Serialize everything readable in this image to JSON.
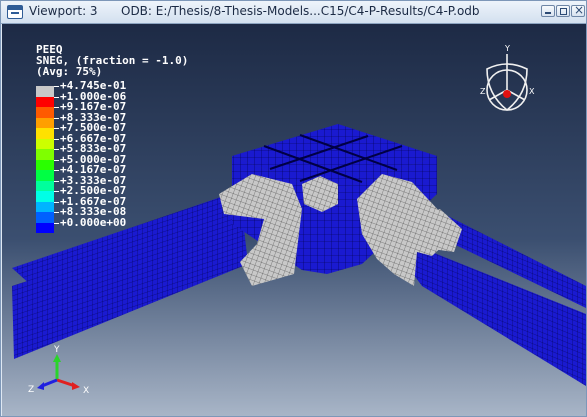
{
  "window": {
    "viewport_label": "Viewport: 3",
    "odb_path": "ODB: E:/Thesis/8-Thesis-Models...C15/C4-P-Results/C4-P.odb"
  },
  "legend": {
    "title_lines": [
      "PEEQ",
      "SNEG, (fraction = -1.0)",
      "(Avg: 75%)"
    ],
    "levels": [
      {
        "label": "+4.745e-01",
        "color": "#c8c8c8"
      },
      {
        "label": "+1.000e-06",
        "color": "#ff0000"
      },
      {
        "label": "+9.167e-07",
        "color": "#ff5a00"
      },
      {
        "label": "+8.333e-07",
        "color": "#ff9f00"
      },
      {
        "label": "+7.500e-07",
        "color": "#ffe100"
      },
      {
        "label": "+6.667e-07",
        "color": "#ccff00"
      },
      {
        "label": "+5.833e-07",
        "color": "#7fff00"
      },
      {
        "label": "+5.000e-07",
        "color": "#2aff00"
      },
      {
        "label": "+4.167e-07",
        "color": "#00ff44"
      },
      {
        "label": "+3.333e-07",
        "color": "#00ff9c"
      },
      {
        "label": "+2.500e-07",
        "color": "#00ffe6"
      },
      {
        "label": "+1.667e-07",
        "color": "#00b4ff"
      },
      {
        "label": "+8.333e-08",
        "color": "#0060ff"
      },
      {
        "label": "+0.000e+00",
        "color": "#0000ff"
      }
    ]
  },
  "triad_top": {
    "y": "Y",
    "z": "Z",
    "x": "X"
  },
  "triad_bottom": {
    "y": "Y",
    "z": "Z",
    "x": "X"
  },
  "colors": {
    "mesh_blue": "#1a1ad0",
    "mesh_line": "#000044",
    "yield_gray": "#c8c8c8"
  }
}
